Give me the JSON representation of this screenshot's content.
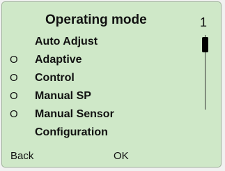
{
  "screen": {
    "title": "Operating mode",
    "page_number": "1"
  },
  "menu": {
    "items": [
      {
        "label": "Auto Adjust",
        "marker": ""
      },
      {
        "label": "Adaptive",
        "marker": "O"
      },
      {
        "label": "Control",
        "marker": "O"
      },
      {
        "label": "Manual SP",
        "marker": "O"
      },
      {
        "label": "Manual Sensor",
        "marker": "O"
      },
      {
        "label": "Configuration",
        "marker": ""
      }
    ]
  },
  "scrollbar": {
    "position_fraction": 0
  },
  "softkeys": {
    "left_label": "Back",
    "right_label": "OK"
  },
  "colors": {
    "lcd_background": "#cfe8c8",
    "text": "#111111"
  }
}
